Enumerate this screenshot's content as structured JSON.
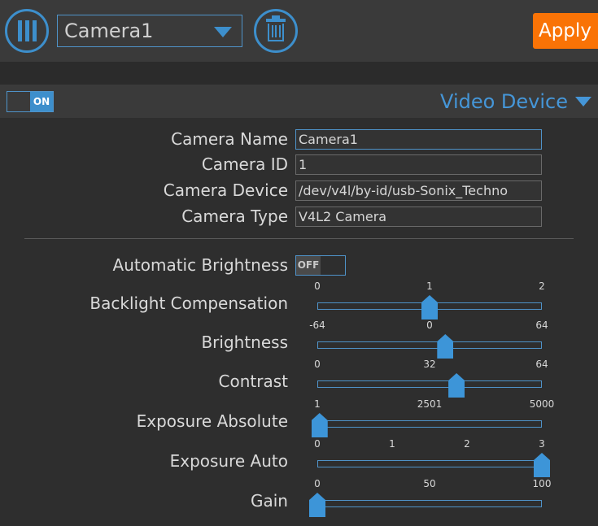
{
  "toolbar": {
    "menu_icon": "three-bars-icon",
    "delete_icon": "trash-icon",
    "camera_select_value": "Camera1",
    "dropdown_icon": "caret-down-icon",
    "apply_label": "Apply"
  },
  "section": {
    "enabled_label": "ON",
    "title": "Video Device",
    "collapse_icon": "caret-down-icon"
  },
  "fields": [
    {
      "label": "Camera Name",
      "value": "Camera1",
      "focused": true
    },
    {
      "label": "Camera ID",
      "value": "1",
      "focused": false
    },
    {
      "label": "Camera Device",
      "value": "/dev/v4l/by-id/usb-Sonix_Techno",
      "focused": false
    },
    {
      "label": "Camera Type",
      "value": "V4L2 Camera",
      "focused": false
    }
  ],
  "auto_brightness": {
    "label": "Automatic Brightness",
    "state": "OFF"
  },
  "sliders": [
    {
      "label": "Backlight Compensation",
      "ticks": [
        "0",
        "1",
        "2"
      ],
      "value_pct": 50
    },
    {
      "label": "Brightness",
      "ticks": [
        "-64",
        "0",
        "64"
      ],
      "value_pct": 57
    },
    {
      "label": "Contrast",
      "ticks": [
        "0",
        "32",
        "64"
      ],
      "value_pct": 62
    },
    {
      "label": "Exposure Absolute",
      "ticks": [
        "1",
        "2501",
        "5000"
      ],
      "value_pct": 1
    },
    {
      "label": "Exposure Auto",
      "ticks": [
        "0",
        "1",
        "2",
        "3"
      ],
      "value_pct": 100
    },
    {
      "label": "Gain",
      "ticks": [
        "0",
        "50",
        "100"
      ],
      "value_pct": 0
    }
  ],
  "colors": {
    "accent_blue": "#3d8fcc",
    "link_blue": "#4596d8",
    "apply_orange": "#f97306",
    "toolbar_bg": "#3a3a3a",
    "panel_bg": "#2e2e2e",
    "window_bg": "#2b2b2b"
  }
}
